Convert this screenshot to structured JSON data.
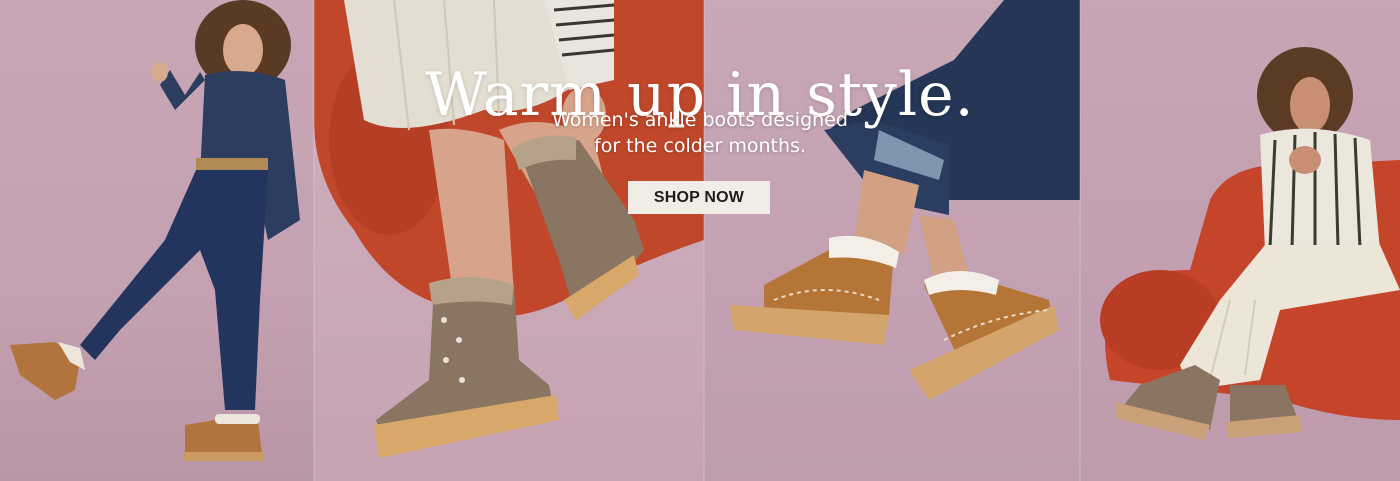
{
  "banner": {
    "headline": "Warm up in style.",
    "subline_1": "Women's ankle boots designed",
    "subline_2": "for the colder months.",
    "cta_label": "SHOP NOW"
  },
  "colors": {
    "background_mauve": "#c9a9b8",
    "chair_red": "#c94a2c",
    "denim": "#26365c",
    "boot_tan": "#b77a3f",
    "boot_taupe": "#8e7765",
    "cta_bg": "#f1ece6"
  },
  "photos": [
    {
      "name": "model-dancing-denim"
    },
    {
      "name": "legs-crossed-lace-up-boots"
    },
    {
      "name": "shearling-trim-boots"
    },
    {
      "name": "model-seated-red-chair"
    }
  ]
}
